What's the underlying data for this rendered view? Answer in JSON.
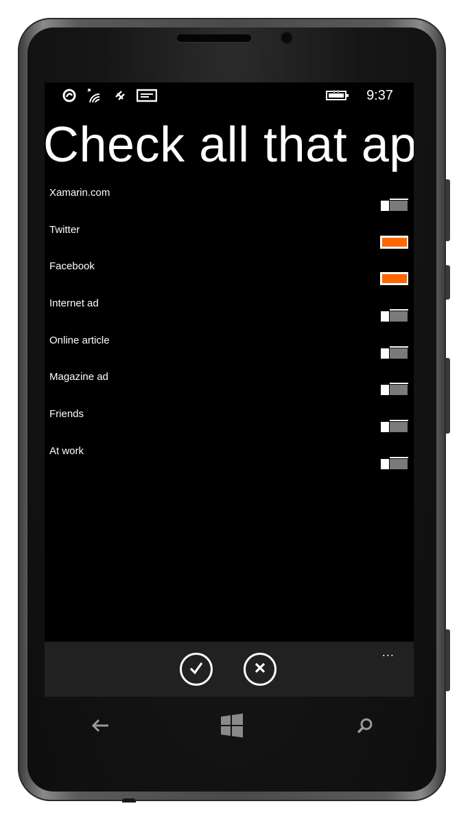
{
  "status_bar": {
    "time": "9:37",
    "icons": [
      "data-sense-icon",
      "wifi-icon",
      "bluetooth-icon",
      "notification-icon",
      "battery-charging-icon"
    ]
  },
  "page": {
    "title": "Check all that apply"
  },
  "options": [
    {
      "label": "Xamarin.com",
      "checked": false
    },
    {
      "label": "Twitter",
      "checked": true
    },
    {
      "label": "Facebook",
      "checked": true
    },
    {
      "label": "Internet ad",
      "checked": false
    },
    {
      "label": "Online article",
      "checked": false
    },
    {
      "label": "Magazine ad",
      "checked": false
    },
    {
      "label": "Friends",
      "checked": false
    },
    {
      "label": "At work",
      "checked": false
    }
  ],
  "app_bar": {
    "buttons": [
      "check-icon",
      "cancel-icon"
    ],
    "more": "..."
  },
  "hardware_keys": [
    "back-icon",
    "windows-icon",
    "search-icon"
  ],
  "colors": {
    "accent": "#ff6600",
    "background": "#000000",
    "appbar": "#212121"
  }
}
